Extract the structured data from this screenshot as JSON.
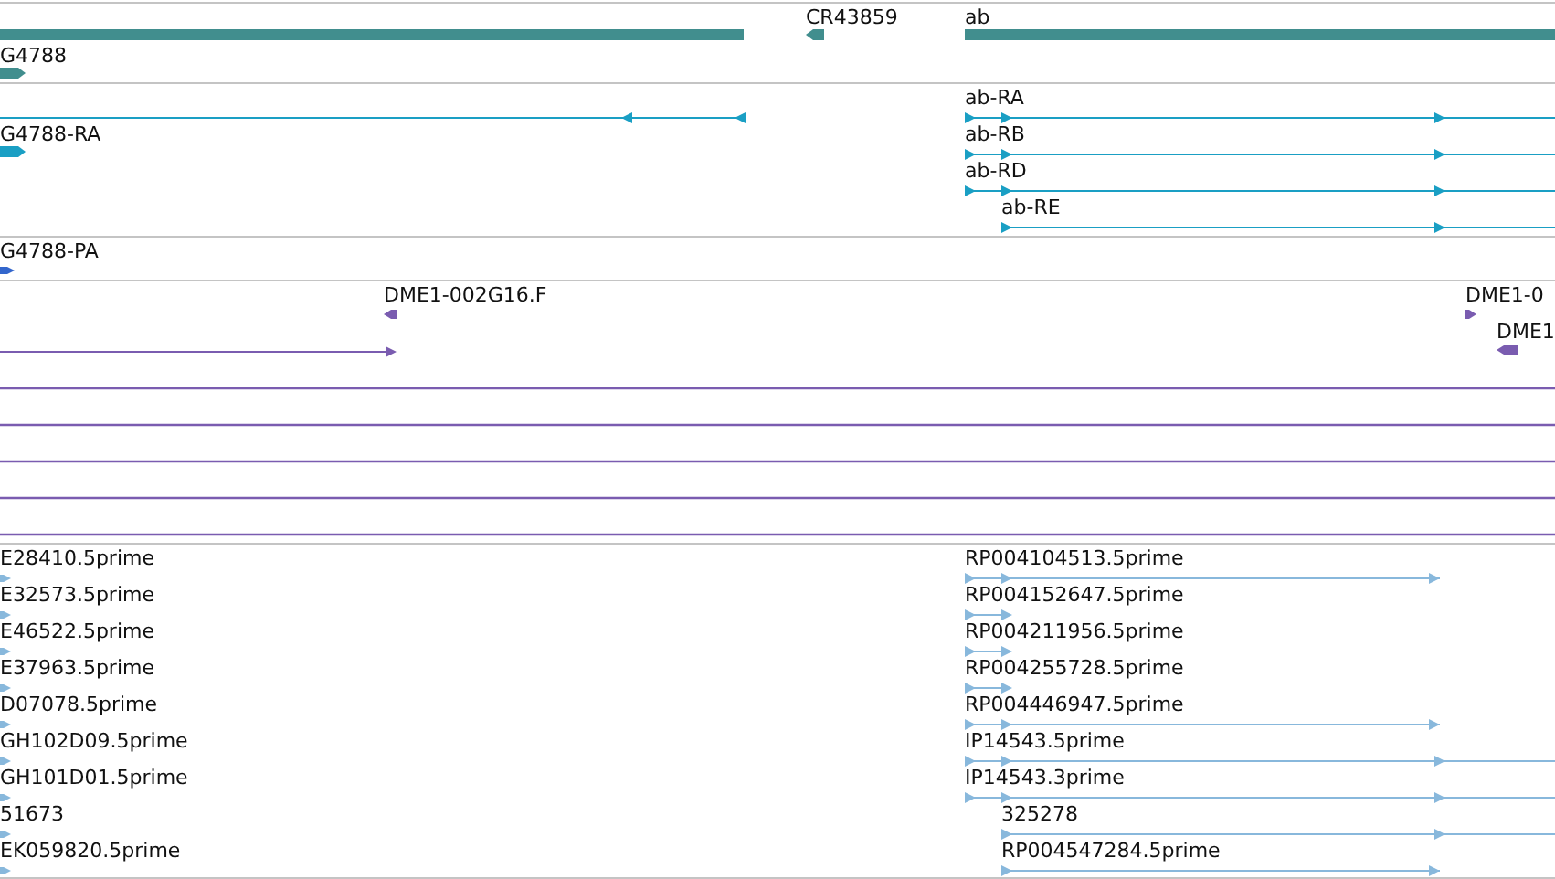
{
  "tracks": [
    {
      "kind": "genes",
      "features": [
        {
          "label": "CR43859",
          "reverse": true
        },
        {
          "label": "ab",
          "reverse": false
        },
        {
          "label": "G4788",
          "reverse": false
        }
      ]
    },
    {
      "kind": "transcripts",
      "features": [
        {
          "label": "ab-RA",
          "reverse": false
        },
        {
          "label": "G4788-RA",
          "reverse": false
        },
        {
          "label": "ab-RB",
          "reverse": false
        },
        {
          "label": "ab-RD",
          "reverse": false
        },
        {
          "label": "ab-RE",
          "reverse": false
        }
      ]
    },
    {
      "kind": "proteins",
      "features": [
        {
          "label": "G4788-PA",
          "reverse": false
        }
      ]
    },
    {
      "kind": "clones",
      "features": [
        {
          "label": "DME1-002G16.F",
          "reverse": true
        },
        {
          "label": "DME1-0",
          "reverse": false
        },
        {
          "label": "DME1",
          "reverse": true
        }
      ]
    },
    {
      "kind": "ests",
      "features": [
        {
          "label": "E28410.5prime",
          "reverse": false
        },
        {
          "label": "RP004104513.5prime",
          "reverse": false
        },
        {
          "label": "E32573.5prime",
          "reverse": false
        },
        {
          "label": "RP004152647.5prime",
          "reverse": false
        },
        {
          "label": "E46522.5prime",
          "reverse": false
        },
        {
          "label": "RP004211956.5prime",
          "reverse": false
        },
        {
          "label": "E37963.5prime",
          "reverse": false
        },
        {
          "label": "RP004255728.5prime",
          "reverse": false
        },
        {
          "label": "D07078.5prime",
          "reverse": false
        },
        {
          "label": "RP004446947.5prime",
          "reverse": false
        },
        {
          "label": "GH102D09.5prime",
          "reverse": false
        },
        {
          "label": "IP14543.5prime",
          "reverse": false
        },
        {
          "label": "GH101D01.5prime",
          "reverse": false
        },
        {
          "label": "IP14543.3prime",
          "reverse": false
        },
        {
          "label": "51673",
          "reverse": false
        },
        {
          "label": "325278",
          "reverse": false
        },
        {
          "label": "EK059820.5prime",
          "reverse": false
        },
        {
          "label": "RP004547284.5prime",
          "reverse": false
        }
      ]
    }
  ]
}
